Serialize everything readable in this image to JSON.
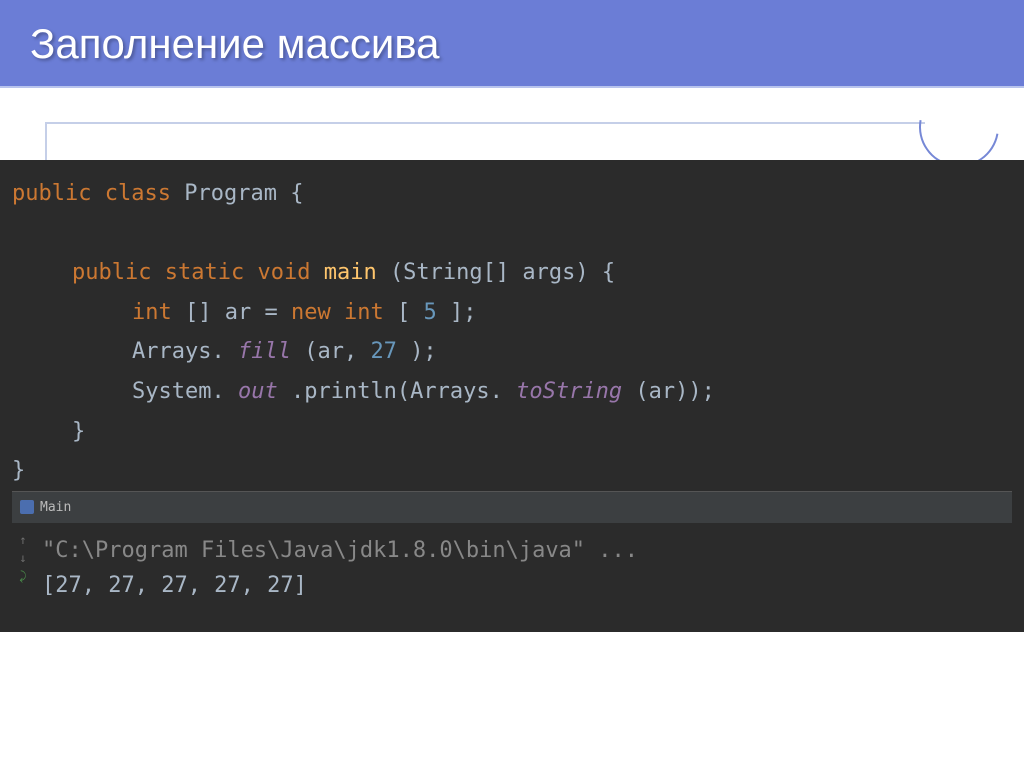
{
  "slide": {
    "title": "Заполнение массива"
  },
  "code": {
    "line1_kw1": "public",
    "line1_kw2": "class",
    "line1_cls": "Program",
    "line1_brace": "{",
    "line2_kw1": "public",
    "line2_kw2": "static",
    "line2_kw3": "void",
    "line2_method": "main",
    "line2_params": "(String[] args) {",
    "line3_kw": "int",
    "line3_var": "[] ar = ",
    "line3_new": "new",
    "line3_type": " int",
    "line3_bracket1": "[",
    "line3_num": "5",
    "line3_bracket2": "];",
    "line4_arrays": "Arrays.",
    "line4_fill": "fill",
    "line4_args1": "(ar, ",
    "line4_num": "27",
    "line4_args2": ");",
    "line5_sys": "System.",
    "line5_out": "out",
    "line5_println": ".println(Arrays.",
    "line5_tostring": "toString",
    "line5_end": "(ar));",
    "line6": "}",
    "line7": "}"
  },
  "console": {
    "tab_label": "Main",
    "path": "\"C:\\Program Files\\Java\\jdk1.8.0\\bin\\java\" ...",
    "output": "[27, 27, 27, 27, 27]"
  }
}
